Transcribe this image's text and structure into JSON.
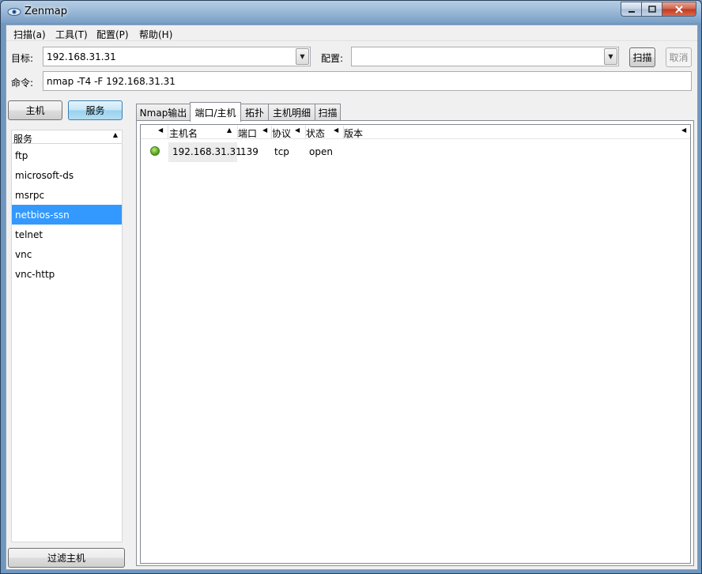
{
  "window": {
    "title": "Zenmap",
    "icon": "zenmap-eye-icon"
  },
  "menu": {
    "items": [
      {
        "label": "扫描(a)"
      },
      {
        "label": "工具(T)"
      },
      {
        "label": "配置(P)"
      },
      {
        "label": "帮助(H)"
      }
    ]
  },
  "toolbar": {
    "target_label": "目标:",
    "target_value": "192.168.31.31",
    "profile_label": "配置:",
    "profile_value": "",
    "scan_button": "扫描",
    "cancel_button": "取消",
    "command_label": "命令:",
    "command_value": "nmap -T4 -F 192.168.31.31"
  },
  "sidebar": {
    "host_button": "主机",
    "service_button": "服务",
    "header": "服务",
    "selected_index": 3,
    "services": [
      "ftp",
      "microsoft-ds",
      "msrpc",
      "netbios-ssn",
      "telnet",
      "vnc",
      "vnc-http"
    ],
    "filter_button": "过滤主机"
  },
  "tabs": [
    {
      "label": "Nmap输出",
      "active": false
    },
    {
      "label": "端口/主机",
      "active": true
    },
    {
      "label": "拓扑",
      "active": false
    },
    {
      "label": "主机明细",
      "active": false
    },
    {
      "label": "扫描",
      "active": false
    }
  ],
  "table": {
    "columns": [
      "主机名",
      "端口",
      "协议",
      "状态",
      "版本"
    ],
    "rows": [
      {
        "status": "up",
        "hostname": "192.168.31.31",
        "port": "139",
        "protocol": "tcp",
        "state": "open",
        "version": ""
      }
    ]
  },
  "colors": {
    "selection": "#3399ff",
    "status_up": "#5aa61e"
  }
}
